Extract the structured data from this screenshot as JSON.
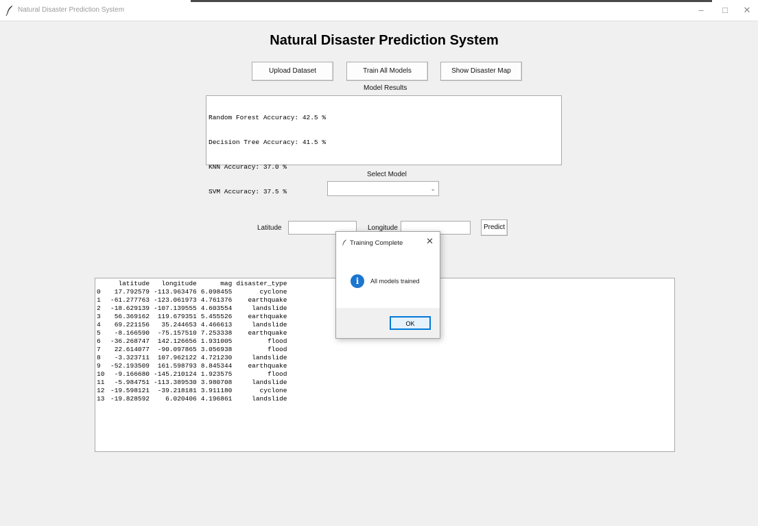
{
  "window": {
    "title": "Natural Disaster Prediction System",
    "minimize": "–",
    "maximize": "□",
    "close": "✕"
  },
  "header": {
    "title": "Natural Disaster Prediction System"
  },
  "toolbar": {
    "upload_label": "Upload Dataset",
    "train_label": "Train All Models",
    "map_label": "Show Disaster Map"
  },
  "results": {
    "label": "Model Results",
    "lines": [
      "Random Forest Accuracy: 42.5 %",
      "Decision Tree Accuracy: 41.5 %",
      "KNN Accuracy: 37.0 %",
      "SVM Accuracy: 37.5 %"
    ]
  },
  "model_select": {
    "label": "Select Model",
    "value": ""
  },
  "predict_form": {
    "latitude_label": "Latitude",
    "latitude_value": "",
    "longitude_label": "Longitude",
    "longitude_value": "",
    "predict_label": "Predict"
  },
  "dataset": {
    "columns": [
      "",
      "latitude",
      "longitude",
      "mag",
      "disaster_type"
    ],
    "rows": [
      [
        "0",
        "17.792579",
        "-113.963476",
        "6.098455",
        "cyclone"
      ],
      [
        "1",
        "-61.277763",
        "-123.061973",
        "4.761376",
        "earthquake"
      ],
      [
        "2",
        "-18.629139",
        "-107.139555",
        "4.603554",
        "landslide"
      ],
      [
        "3",
        "56.369162",
        "119.679351",
        "5.455526",
        "earthquake"
      ],
      [
        "4",
        "69.221156",
        "35.244653",
        "4.466613",
        "landslide"
      ],
      [
        "5",
        "-8.166590",
        "-75.157510",
        "7.253338",
        "earthquake"
      ],
      [
        "6",
        "-36.268747",
        "142.126656",
        "1.931005",
        "flood"
      ],
      [
        "7",
        "22.614077",
        "-90.097865",
        "3.056938",
        "flood"
      ],
      [
        "8",
        "-3.323711",
        "107.962122",
        "4.721230",
        "landslide"
      ],
      [
        "9",
        "-52.193509",
        "161.598793",
        "8.845344",
        "earthquake"
      ],
      [
        "10",
        "-9.166680",
        "-145.210124",
        "1.923575",
        "flood"
      ],
      [
        "11",
        "-5.984751",
        "-113.389530",
        "3.980708",
        "landslide"
      ],
      [
        "12",
        "-19.598121",
        "-39.218181",
        "3.911180",
        "cyclone"
      ],
      [
        "13",
        "-19.828592",
        "6.020406",
        "4.196861",
        "landslide"
      ]
    ]
  },
  "dialog": {
    "title": "Training Complete",
    "message": "All models trained",
    "ok_label": "OK",
    "close": "✕",
    "icon": "info-icon"
  }
}
